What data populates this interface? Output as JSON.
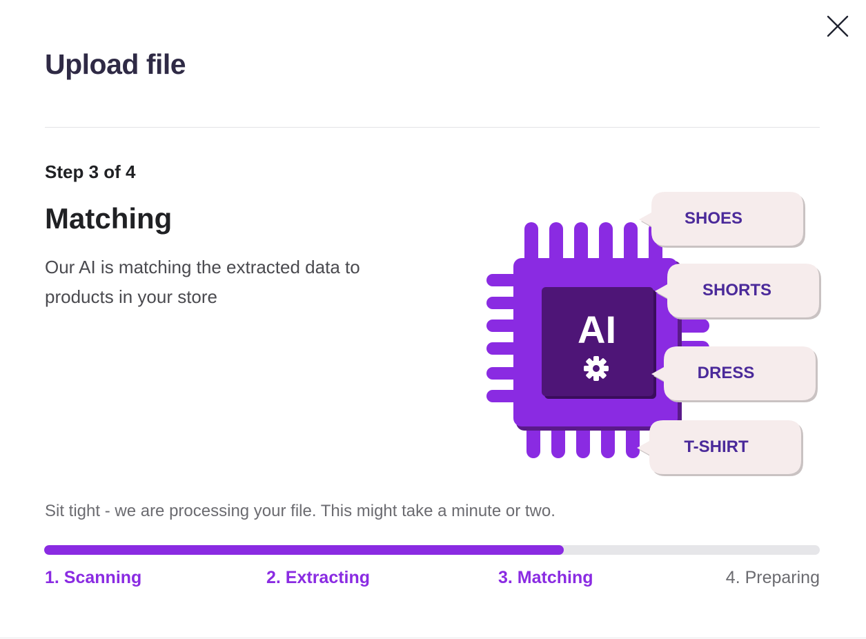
{
  "modal": {
    "title": "Upload file",
    "close_icon": "close-icon"
  },
  "step": {
    "label": "Step 3 of 4",
    "title": "Matching",
    "description": "Our AI is matching the extracted data to products in your store"
  },
  "illustration": {
    "chip_label": "AI",
    "chip_icon": "gear-icon",
    "tags": [
      "SHOES",
      "SHORTS",
      "DRESS",
      "T-SHIRT"
    ]
  },
  "status": {
    "message": "Sit tight - we are processing your file. This might take a minute or two."
  },
  "progress": {
    "fraction": 0.67,
    "stages": [
      {
        "label": "1. Scanning",
        "state": "done"
      },
      {
        "label": "2. Extracting",
        "state": "done"
      },
      {
        "label": "3. Matching",
        "state": "active"
      },
      {
        "label": "4. Preparing",
        "state": "pending"
      }
    ]
  },
  "colors": {
    "accent": "#8a2be2",
    "chip_inner": "#4e1577",
    "tag_bg": "#f6ecec",
    "tag_text": "#4b2a9a",
    "title_text": "#2f2a45"
  }
}
